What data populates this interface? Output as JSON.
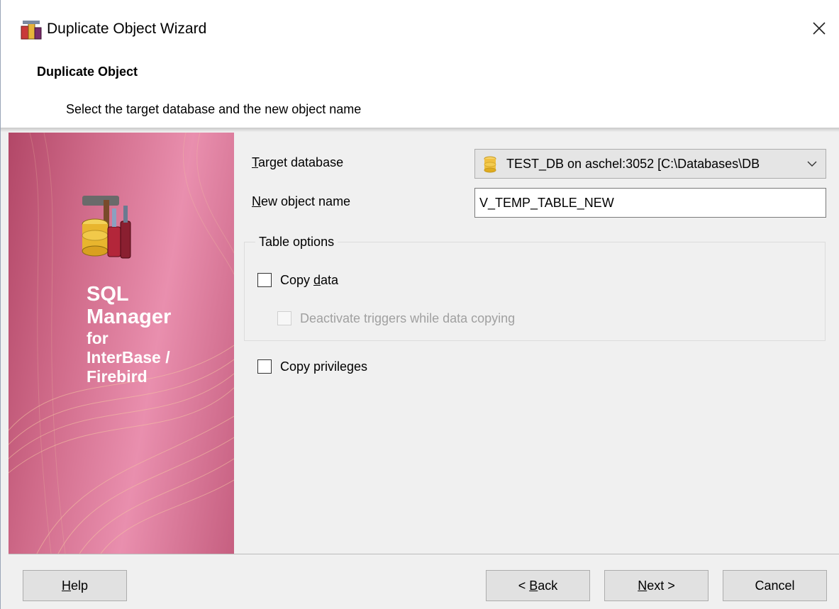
{
  "window": {
    "title": "Duplicate Object Wizard",
    "close_glyph": "✕"
  },
  "header": {
    "title": "Duplicate Object",
    "subtitle": "Select the target database and the new object name"
  },
  "banner": {
    "line1": "SQL",
    "line2": "Manager",
    "line3": "for",
    "line4": "InterBase /",
    "line5": "Firebird"
  },
  "form": {
    "target_db_label_pre": "",
    "target_db_label_u": "T",
    "target_db_label_post": "arget database",
    "target_db_value": "TEST_DB on aschel:3052 [C:\\Databases\\DB",
    "new_name_label_u": "N",
    "new_name_label_post": "ew object name",
    "new_name_value": "V_TEMP_TABLE_NEW"
  },
  "table_options": {
    "legend": "Table options",
    "copy_data_pre": "Copy ",
    "copy_data_u": "d",
    "copy_data_post": "ata",
    "copy_data_checked": false,
    "deactivate_triggers": "Deactivate triggers while data copying",
    "deactivate_triggers_checked": false,
    "deactivate_triggers_enabled": false
  },
  "copy_privileges": {
    "label": "Copy privileges",
    "checked": false
  },
  "buttons": {
    "help_u": "H",
    "help_post": "elp",
    "back_pre": "< ",
    "back_u": "B",
    "back_post": "ack",
    "next_u": "N",
    "next_post": "ext >",
    "cancel": "Cancel"
  },
  "icons": {
    "app": "wizard-app-icon",
    "close": "close-icon",
    "database": "database-icon",
    "chevron": "chevron-down-icon",
    "logo": "sql-manager-logo-icon"
  }
}
